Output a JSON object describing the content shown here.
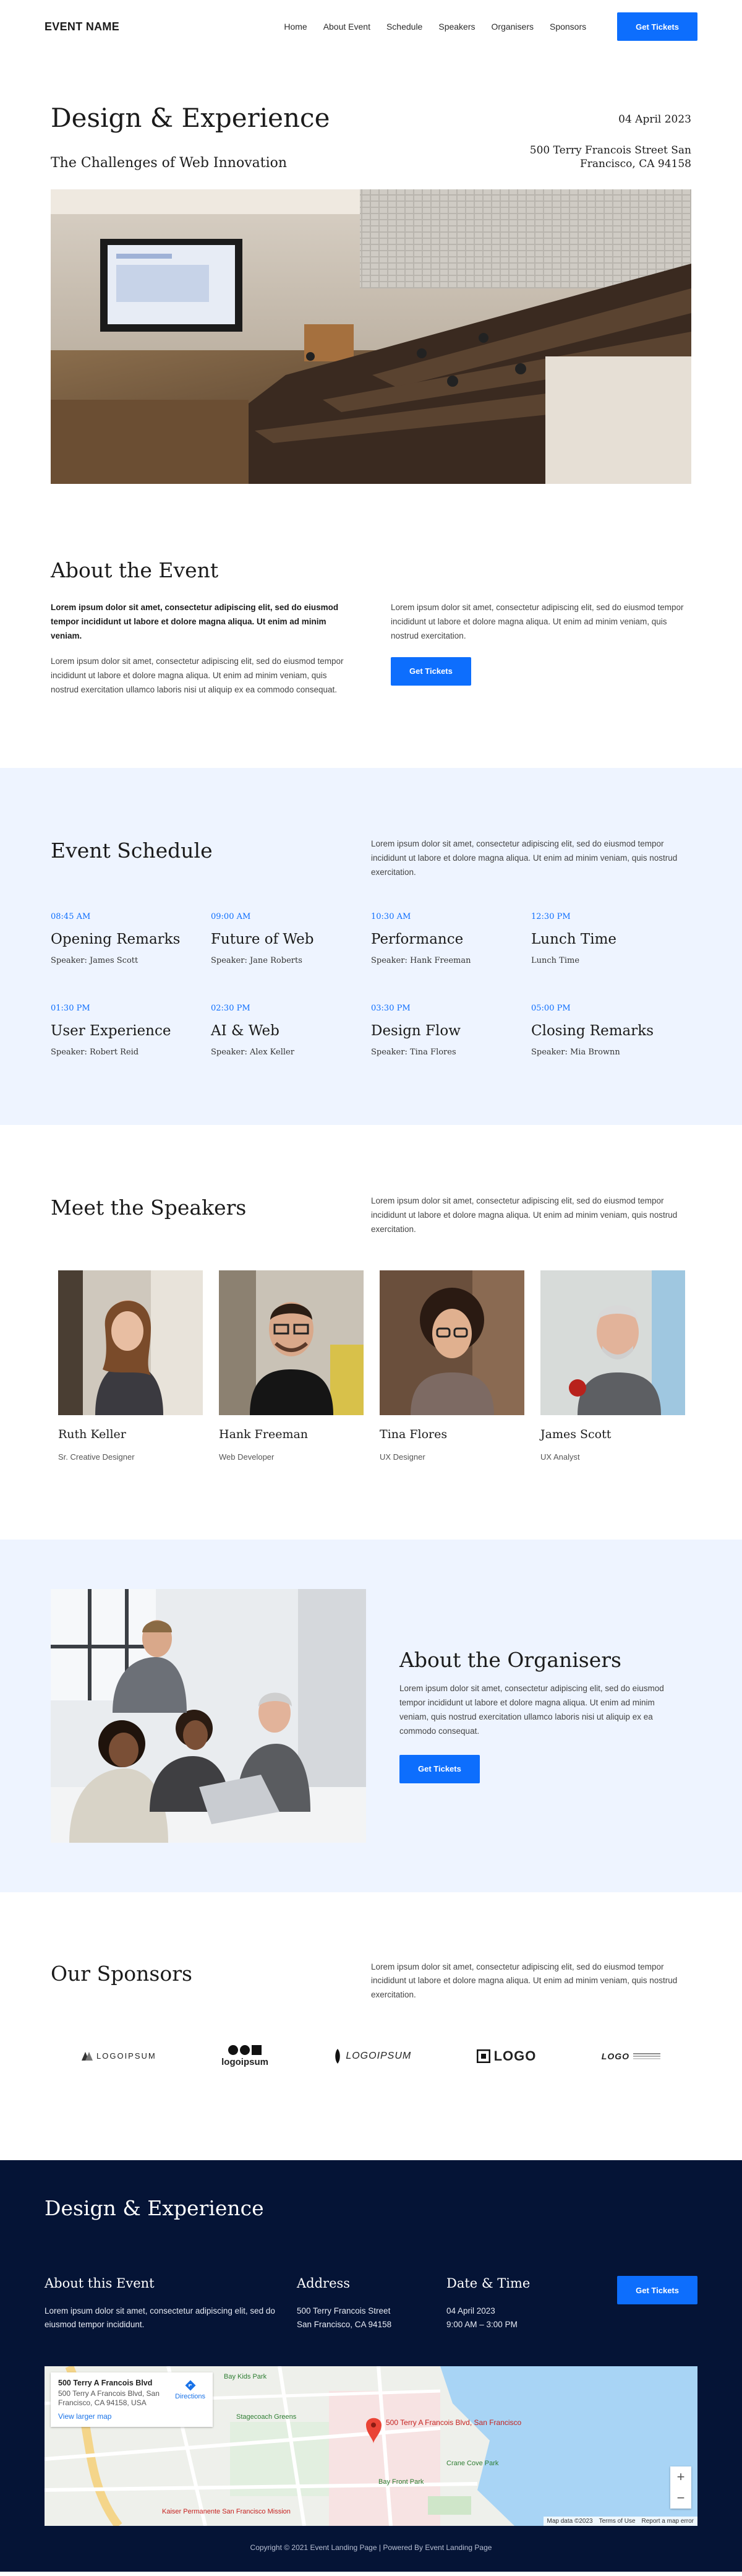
{
  "header": {
    "brand": "EVENT NAME",
    "nav": [
      "Home",
      "About Event",
      "Schedule",
      "Speakers",
      "Organisers",
      "Sponsors"
    ],
    "cta": "Get Tickets"
  },
  "hero": {
    "title": "Design & Experience",
    "subtitle": "The Challenges of Web Innovation",
    "date": "04 April 2023",
    "address_line1": "500 Terry Francois Street San",
    "address_line2": "Francisco, CA 94158"
  },
  "about": {
    "heading": "About the Event",
    "lead": "Lorem ipsum dolor sit amet, consectetur adipiscing elit, sed do eiusmod tempor incididunt ut labore et dolore magna aliqua. Ut enim ad minim veniam.",
    "body": "Lorem ipsum dolor sit amet, consectetur adipiscing elit, sed do eiusmod tempor incididunt ut labore et dolore magna aliqua. Ut enim ad minim veniam, quis nostrud exercitation ullamco laboris nisi ut aliquip ex ea commodo consequat.",
    "right": "Lorem ipsum dolor sit amet, consectetur adipiscing elit, sed do eiusmod tempor incididunt ut labore et dolore magna aliqua. Ut enim ad minim veniam, quis nostrud exercitation.",
    "cta": "Get Tickets"
  },
  "schedule": {
    "heading": "Event Schedule",
    "intro": "Lorem ipsum dolor sit amet, consectetur adipiscing elit, sed do eiusmod tempor incididunt ut labore et dolore magna aliqua. Ut enim ad minim veniam, quis nostrud exercitation.",
    "slots": [
      {
        "time": "08:45 AM",
        "title": "Opening Remarks",
        "speaker": "Speaker: James Scott"
      },
      {
        "time": "09:00 AM",
        "title": "Future of Web",
        "speaker": "Speaker: Jane Roberts"
      },
      {
        "time": "10:30 AM",
        "title": "Performance",
        "speaker": "Speaker: Hank Freeman"
      },
      {
        "time": "12:30 PM",
        "title": "Lunch Time",
        "speaker": "Lunch Time"
      },
      {
        "time": "01:30 PM",
        "title": "User Experience",
        "speaker": "Speaker: Robert Reid"
      },
      {
        "time": "02:30 PM",
        "title": "AI & Web",
        "speaker": "Speaker: Alex Keller"
      },
      {
        "time": "03:30 PM",
        "title": "Design Flow",
        "speaker": "Speaker: Tina Flores"
      },
      {
        "time": "05:00 PM",
        "title": "Closing Remarks",
        "speaker": "Speaker: Mia Brownn"
      }
    ]
  },
  "speakers": {
    "heading": "Meet the Speakers",
    "intro": "Lorem ipsum dolor sit amet, consectetur adipiscing elit, sed do eiusmod tempor incididunt ut labore et dolore magna aliqua. Ut enim ad minim veniam, quis nostrud exercitation.",
    "people": [
      {
        "name": "Ruth Keller",
        "role": "Sr. Creative Designer"
      },
      {
        "name": "Hank Freeman",
        "role": "Web Developer"
      },
      {
        "name": "Tina Flores",
        "role": "UX Designer"
      },
      {
        "name": "James Scott",
        "role": "UX Analyst"
      }
    ]
  },
  "organisers": {
    "heading": "About the Organisers",
    "body": "Lorem ipsum dolor sit amet, consectetur adipiscing elit, sed do eiusmod tempor incididunt ut labore et dolore magna aliqua. Ut enim ad minim veniam, quis nostrud exercitation ullamco laboris nisi ut aliquip ex ea commodo consequat.",
    "cta": "Get Tickets"
  },
  "sponsors": {
    "heading": "Our Sponsors",
    "intro": "Lorem ipsum dolor sit amet, consectetur adipiscing elit, sed do eiusmod tempor incididunt ut labore et dolore magna aliqua. Ut enim ad minim veniam, quis nostrud exercitation.",
    "logos": [
      "LOGOIPSUM",
      "logoipsum",
      "LOGOIPSUM",
      "LOGO",
      "LOGO"
    ]
  },
  "footer": {
    "title": "Design & Experience",
    "about_heading": "About this Event",
    "about_text": "Lorem ipsum dolor sit amet, consectetur adipiscing elit, sed do eiusmod tempor incididunt.",
    "address_heading": "Address",
    "address_line1": "500 Terry Francois Street",
    "address_line2": "San Francisco, CA 94158",
    "datetime_heading": "Date & Time",
    "date": "04 April 2023",
    "time": "9:00 AM – 3:00 PM",
    "cta": "Get Tickets",
    "map": {
      "place": "500 Terry A Francois Blvd",
      "address": "500 Terry A Francois Blvd, San Francisco, CA 94158, USA",
      "larger_link": "View larger map",
      "directions": "Directions",
      "pin_label": "500 Terry A Francois Blvd, San Francisco",
      "labels": [
        "Bay Kids Park",
        "Stagecoach Greens",
        "Crane Cove Park",
        "Kaiser Permanente San Francisco Mission",
        "Bay Front Park"
      ],
      "attribution": [
        "Map data ©2023",
        "Terms of Use",
        "Report a map error"
      ]
    },
    "copyright": "Copyright © 2021 Event Landing Page | Powered By Event Landing Page"
  },
  "colors": {
    "accent": "#0d6efd",
    "light_bg": "#eef4ff",
    "footer_bg": "#051436"
  }
}
